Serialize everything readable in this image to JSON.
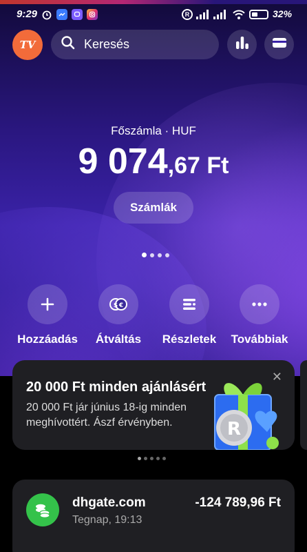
{
  "status_bar": {
    "time": "9:29",
    "battery": "32%"
  },
  "header": {
    "avatar_initials": "TV",
    "search_placeholder": "Keresés"
  },
  "account": {
    "label": "Főszámla · HUF",
    "balance_main": "9 074",
    "balance_decimal": ",67 Ft",
    "accounts_button": "Számlák"
  },
  "actions": [
    {
      "label": "Hozzáadás",
      "icon": "plus-icon"
    },
    {
      "label": "Átváltás",
      "icon": "exchange-icon"
    },
    {
      "label": "Részletek",
      "icon": "details-icon"
    },
    {
      "label": "Továbbiak",
      "icon": "more-icon"
    }
  ],
  "promo": {
    "title": "20 000 Ft minden ajánlásért",
    "body": "20 000 Ft jár június 18-ig minden meghívottért. Ászf érvényben."
  },
  "transactions": [
    {
      "merchant": "dhgate.com",
      "time": "Tegnap, 19:13",
      "amount": "-124 789,96 Ft"
    }
  ],
  "colors": {
    "avatar": "#f26b3a",
    "tx_icon": "#34c24a"
  }
}
